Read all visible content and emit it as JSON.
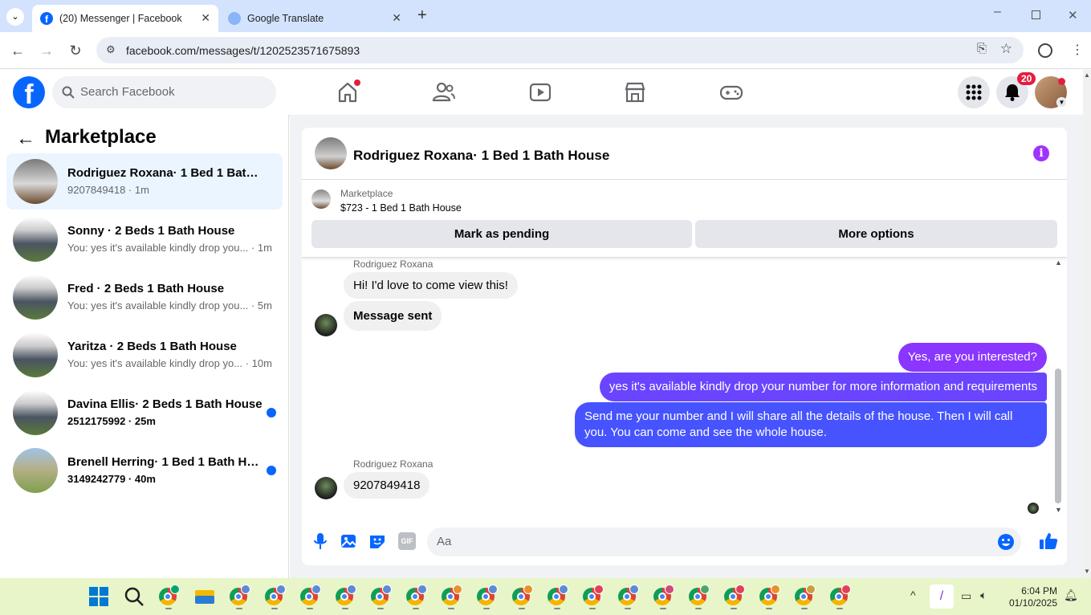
{
  "browser": {
    "tabs": [
      {
        "title": "(20) Messenger | Facebook",
        "active": true
      },
      {
        "title": "Google Translate",
        "active": false
      }
    ],
    "url": "facebook.com/messages/t/1202523571675893"
  },
  "fb_header": {
    "search_placeholder": "Search Facebook",
    "notifications_count": "20"
  },
  "sidebar": {
    "title": "Marketplace",
    "conversations": [
      {
        "name": "Rodriguez Roxana· 1 Bed 1 Bath H...",
        "preview": "9207849418 · 1m",
        "selected": true,
        "unread": false
      },
      {
        "name": "Sonny · 2 Beds 1 Bath House",
        "preview": "You: yes it's available kindly drop you... · 1m",
        "selected": false,
        "unread": false
      },
      {
        "name": "Fred · 2 Beds 1 Bath House",
        "preview": "You: yes it's available kindly drop you... · 5m",
        "selected": false,
        "unread": false
      },
      {
        "name": "Yaritza · 2 Beds 1 Bath House",
        "preview": "You: yes it's available kindly drop yo... · 10m",
        "selected": false,
        "unread": false
      },
      {
        "name": "Davina Ellis· 2 Beds 1 Bath House",
        "preview": "2512175992 · 25m",
        "selected": false,
        "unread": true
      },
      {
        "name": "Brenell Herring· 1 Bed 1 Bath Ho...",
        "preview": "3149242779 · 40m",
        "selected": false,
        "unread": true
      }
    ]
  },
  "chat": {
    "title": "Rodriguez Roxana· 1 Bed 1 Bath House",
    "marketplace_label": "Marketplace",
    "listing": "$723 - 1 Bed 1 Bath House",
    "mark_pending": "Mark as pending",
    "more_options": "More options",
    "messages": [
      {
        "sender": "Rodriguez Roxana",
        "text": "Hi! I'd love to come view this!",
        "dir": "in"
      },
      {
        "text": "Message sent",
        "dir": "in"
      },
      {
        "text": "Yes, are you interested?",
        "dir": "out"
      },
      {
        "text": "yes it's available kindly drop your number for more information and requirements",
        "dir": "out"
      },
      {
        "text": "Send me your number and I will share all the details of the house. Then I will call you. You can come and see the whole house.",
        "dir": "out"
      },
      {
        "sender": "Rodriguez Roxana",
        "text": "9207849418",
        "dir": "in"
      }
    ],
    "composer_placeholder": "Aa"
  },
  "taskbar": {
    "time": "6:04 PM",
    "date": "01/10/2025"
  },
  "colors": {
    "fb_blue": "#0866ff",
    "out_bubble_start": "#a033ff",
    "out_bubble_end": "#3c5cff"
  }
}
